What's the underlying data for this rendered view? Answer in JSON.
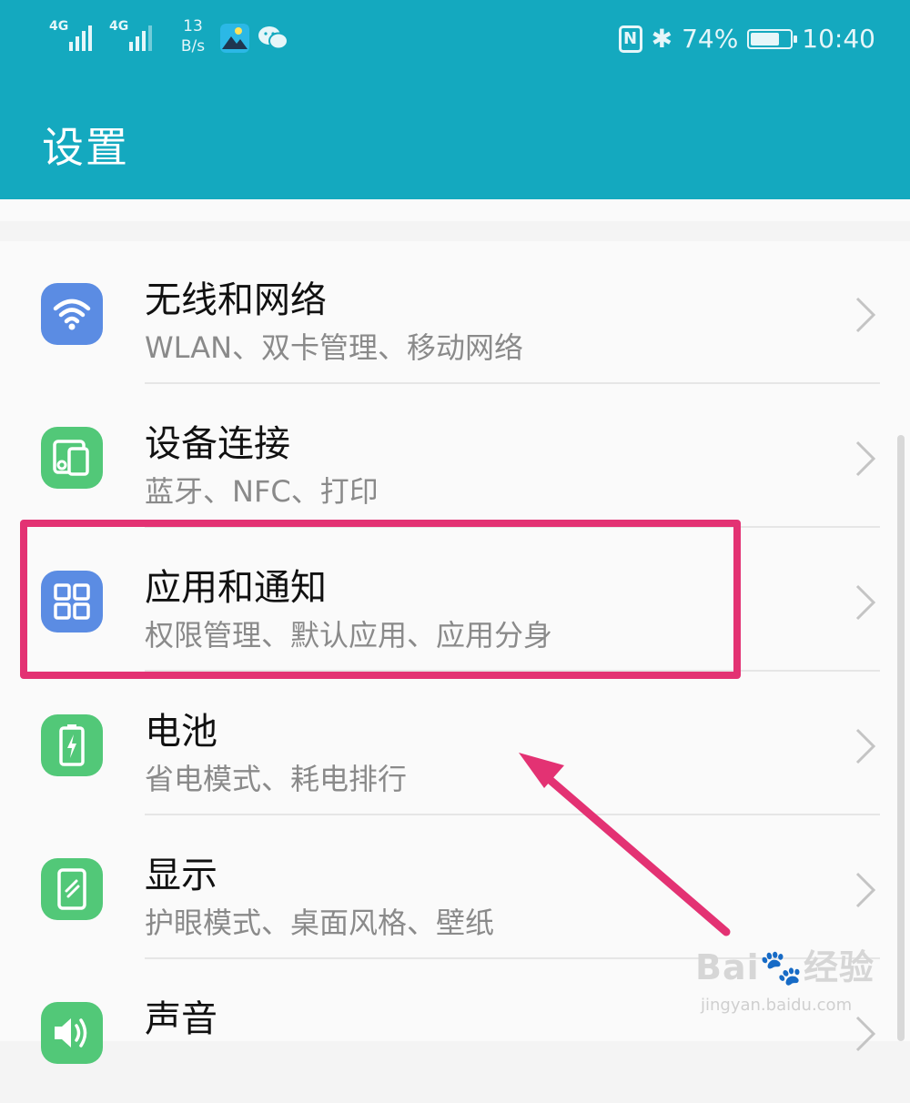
{
  "status_bar": {
    "sim1_label": "4G",
    "sim2_label": "4G",
    "speed_value": "13",
    "speed_unit": "B/s",
    "nfc_glyph": "N",
    "bluetooth_glyph": "✱",
    "battery_percent_text": "74%",
    "battery_level_percent": 74,
    "time": "10:40",
    "icons": [
      "signal-4g-icon",
      "photo-app-icon",
      "wechat-icon",
      "nfc-icon",
      "bluetooth-icon",
      "battery-icon"
    ]
  },
  "header": {
    "title": "设置"
  },
  "settings": [
    {
      "id": "wireless",
      "title": "无线和网络",
      "subtitle": "WLAN、双卡管理、移动网络",
      "icon": "wifi-icon",
      "color": "#5b8ce3"
    },
    {
      "id": "device",
      "title": "设备连接",
      "subtitle": "蓝牙、NFC、打印",
      "icon": "device-connection-icon",
      "color": "#52c878"
    },
    {
      "id": "apps",
      "title": "应用和通知",
      "subtitle": "权限管理、默认应用、应用分身",
      "icon": "apps-grid-icon",
      "color": "#5b8ce3"
    },
    {
      "id": "battery",
      "title": "电池",
      "subtitle": "省电模式、耗电排行",
      "icon": "battery-charging-icon",
      "color": "#52c878"
    },
    {
      "id": "display",
      "title": "显示",
      "subtitle": "护眼模式、桌面风格、壁纸",
      "icon": "display-icon",
      "color": "#52c878"
    },
    {
      "id": "sound",
      "title": "声音",
      "subtitle": "",
      "icon": "speaker-icon",
      "color": "#52c878"
    }
  ],
  "annotation": {
    "highlight_color": "#e33273",
    "highlighted_item": "apps"
  },
  "watermark": {
    "brand": "Bai",
    "brand2": "经验",
    "site": "jingyan.baidu.com"
  }
}
